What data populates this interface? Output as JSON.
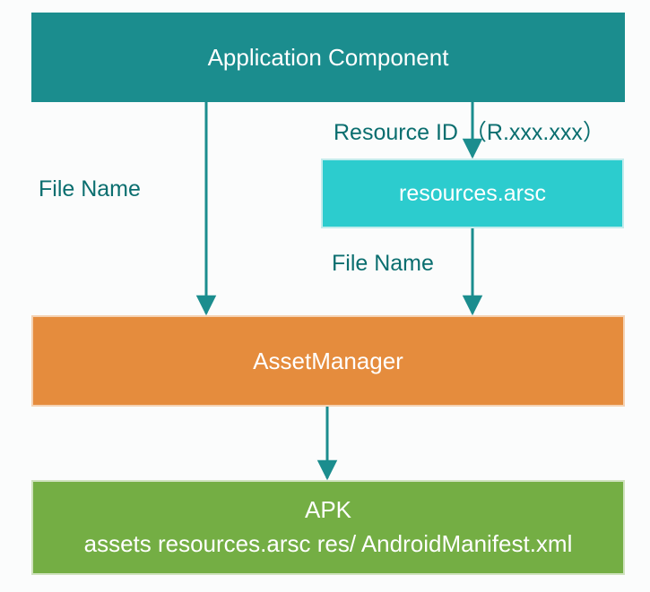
{
  "boxes": {
    "app_component": "Application Component",
    "resources_arsc": "resources.arsc",
    "asset_manager": "AssetManager",
    "apk_title": "APK",
    "apk_sub": "assets resources.arsc res/ AndroidManifest.xml"
  },
  "labels": {
    "resource_id": "Resource ID （R.xxx.xxx）",
    "file_name_left": "File Name",
    "file_name_mid": "File Name"
  },
  "arrows": [
    {
      "name": "app-to-assetmanager",
      "from": "app_component",
      "to": "asset_manager"
    },
    {
      "name": "app-to-resources",
      "from": "app_component",
      "to": "resources_arsc"
    },
    {
      "name": "resources-to-assetmanager",
      "from": "resources_arsc",
      "to": "asset_manager"
    },
    {
      "name": "assetmanager-to-apk",
      "from": "asset_manager",
      "to": "apk"
    }
  ],
  "colors": {
    "teal_dark": "#1b8d8e",
    "teal_light": "#2cccce",
    "orange": "#e58c3d",
    "green": "#74ae44",
    "arrow": "#1b8d8e",
    "text_teal": "#0a6e6f"
  }
}
